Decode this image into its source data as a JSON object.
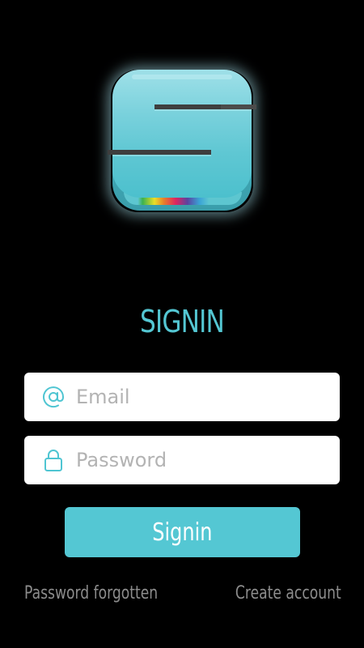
{
  "logo": {
    "icon": "s-logo-icon",
    "accent_color": "#54c7d3"
  },
  "title": "SIGNIN",
  "form": {
    "email": {
      "icon": "at-sign-icon",
      "placeholder": "Email",
      "value": ""
    },
    "password": {
      "icon": "lock-icon",
      "placeholder": "Password",
      "value": ""
    },
    "submit_label": "Signin"
  },
  "links": {
    "forgot_password": "Password forgotten",
    "create_account": "Create account"
  },
  "colors": {
    "background": "#000000",
    "accent": "#54c7d3",
    "field_background": "#ffffff",
    "placeholder": "#b3b3b3",
    "link": "#8c8c8c"
  }
}
